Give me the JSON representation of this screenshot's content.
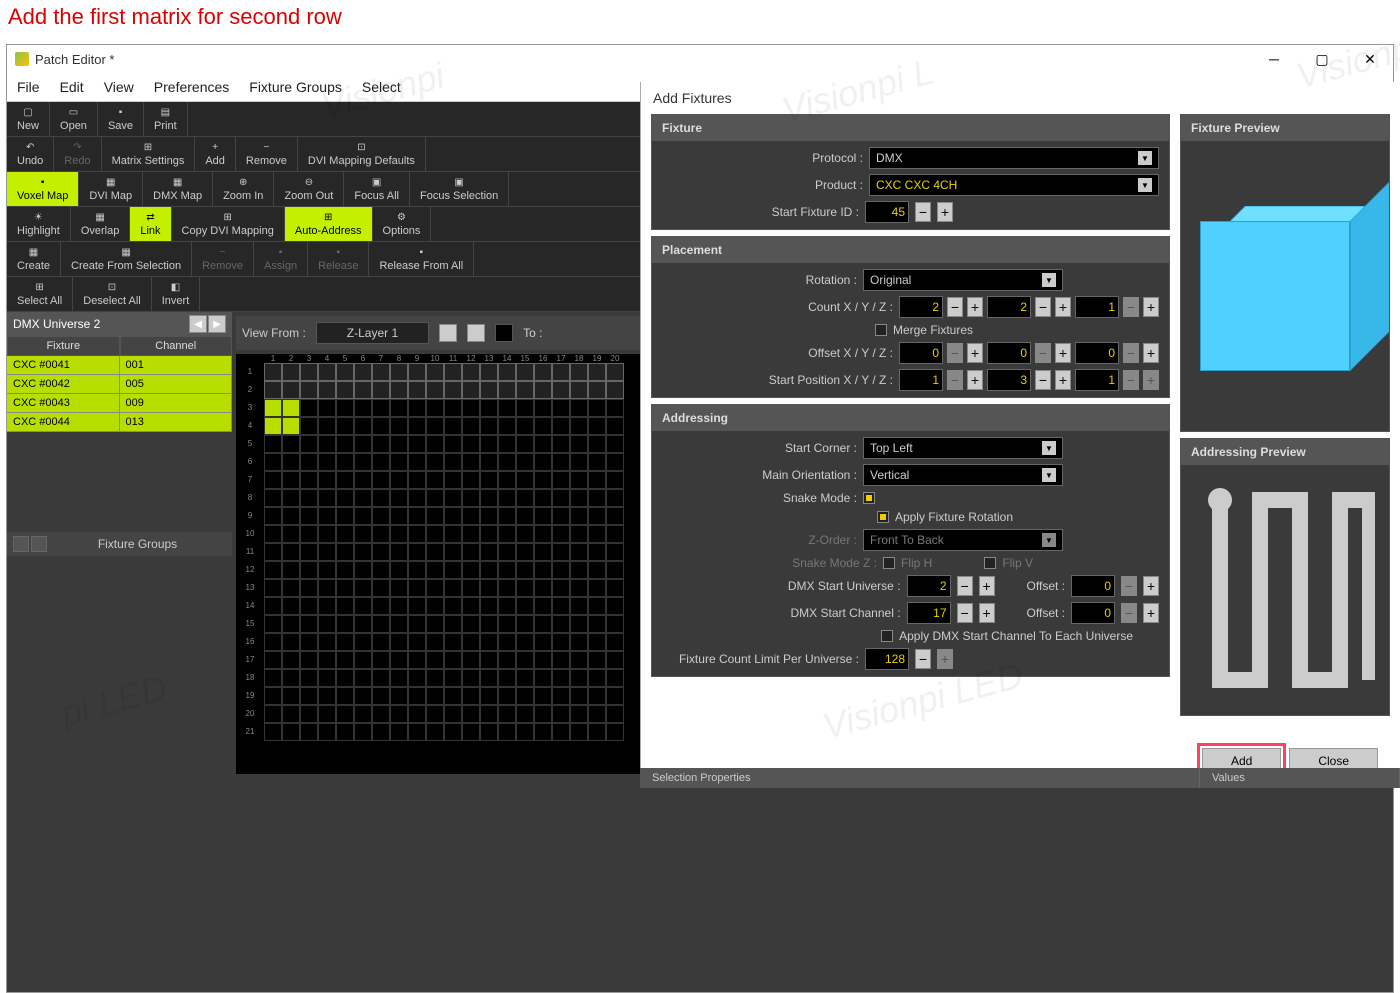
{
  "instruction": "Add the first matrix for second row",
  "window_title": "Patch Editor *",
  "menubar": [
    "File",
    "Edit",
    "View",
    "Preferences",
    "Fixture Groups",
    "Select"
  ],
  "toolbar1": [
    {
      "label": "New",
      "icon": "▢"
    },
    {
      "label": "Open",
      "icon": "▭"
    },
    {
      "label": "Save",
      "icon": "▪"
    },
    {
      "label": "Print",
      "icon": "▤"
    }
  ],
  "toolbar2": [
    {
      "label": "Undo",
      "icon": "↶"
    },
    {
      "label": "Redo",
      "icon": "↷",
      "disabled": true
    },
    {
      "label": "Matrix Settings",
      "icon": "⊞"
    },
    {
      "label": "Add",
      "icon": "+"
    },
    {
      "label": "Remove",
      "icon": "−"
    },
    {
      "label": "DVI Mapping Defaults",
      "icon": "⊡"
    }
  ],
  "toolbar3": [
    {
      "label": "Voxel Map",
      "active": true
    },
    {
      "label": "DVI Map",
      "icon": "▦"
    },
    {
      "label": "DMX Map",
      "icon": "▦"
    },
    {
      "label": "Zoom In",
      "icon": "⊕"
    },
    {
      "label": "Zoom Out",
      "icon": "⊖"
    },
    {
      "label": "Focus All",
      "icon": "▣"
    },
    {
      "label": "Focus Selection",
      "icon": "▣"
    }
  ],
  "toolbar4": [
    {
      "label": "Highlight",
      "icon": "☀"
    },
    {
      "label": "Overlap",
      "icon": "▦"
    },
    {
      "label": "Link",
      "active": true,
      "icon": "⇄"
    },
    {
      "label": "Copy DVI Mapping",
      "icon": "⊞"
    },
    {
      "label": "Auto-Address",
      "active": true,
      "icon": "⊞"
    },
    {
      "label": "Options",
      "icon": "⚙"
    }
  ],
  "toolbar5": [
    {
      "label": "Create",
      "icon": "▦"
    },
    {
      "label": "Create From Selection",
      "icon": "▦"
    },
    {
      "label": "Remove",
      "icon": "−",
      "disabled": true
    },
    {
      "label": "Assign",
      "disabled": true
    },
    {
      "label": "Release",
      "disabled": true
    },
    {
      "label": "Release From All"
    }
  ],
  "toolbar6": [
    {
      "label": "Select All",
      "icon": "⊞"
    },
    {
      "label": "Deselect All",
      "icon": "⊡"
    },
    {
      "label": "Invert",
      "icon": "◧"
    }
  ],
  "universe_title": "DMX Universe 2",
  "fixture_hdr": {
    "c1": "Fixture",
    "c2": "Channel"
  },
  "fixtures": [
    {
      "name": "CXC #0041",
      "ch": "001"
    },
    {
      "name": "CXC #0042",
      "ch": "005"
    },
    {
      "name": "CXC #0043",
      "ch": "009"
    },
    {
      "name": "CXC #0044",
      "ch": "013"
    }
  ],
  "groups_title": "Fixture Groups",
  "view_from": "View From :",
  "layer": "Z-Layer 1",
  "to_label": "To :",
  "dialog": {
    "title": "Add Fixtures",
    "fixture_section": "Fixture",
    "protocol_label": "Protocol :",
    "protocol_value": "DMX",
    "product_label": "Product :",
    "product_value": "CXC CXC 4CH",
    "start_id_label": "Start Fixture ID :",
    "start_id_value": "45",
    "placement_section": "Placement",
    "rotation_label": "Rotation :",
    "rotation_value": "Original",
    "count_label": "Count X / Y / Z :",
    "count_x": "2",
    "count_y": "2",
    "count_z": "1",
    "merge_label": "Merge Fixtures",
    "offset_label": "Offset X / Y / Z :",
    "offset_x": "0",
    "offset_y": "0",
    "offset_z": "0",
    "startpos_label": "Start Position X / Y / Z :",
    "startpos_x": "1",
    "startpos_y": "3",
    "startpos_z": "1",
    "addressing_section": "Addressing",
    "corner_label": "Start Corner :",
    "corner_value": "Top Left",
    "orient_label": "Main Orientation :",
    "orient_value": "Vertical",
    "snake_label": "Snake Mode :",
    "apply_rot_label": "Apply Fixture Rotation",
    "zorder_label": "Z-Order :",
    "zorder_value": "Front To Back",
    "snakez_label": "Snake Mode Z :",
    "fliph_label": "Flip H",
    "flipv_label": "Flip V",
    "dmx_univ_label": "DMX Start Universe :",
    "dmx_univ_value": "2",
    "offset1_label": "Offset :",
    "offset1_value": "0",
    "dmx_chan_label": "DMX Start Channel :",
    "dmx_chan_value": "17",
    "offset2_label": "Offset :",
    "offset2_value": "0",
    "apply_dmx_label": "Apply DMX Start Channel To Each Universe",
    "limit_label": "Fixture Count Limit Per Universe :",
    "limit_value": "128",
    "preview_title": "Fixture Preview",
    "addr_preview_title": "Addressing Preview",
    "add_btn": "Add",
    "close_btn": "Close"
  },
  "status": {
    "sel": "Selection Properties",
    "val": "Values"
  }
}
